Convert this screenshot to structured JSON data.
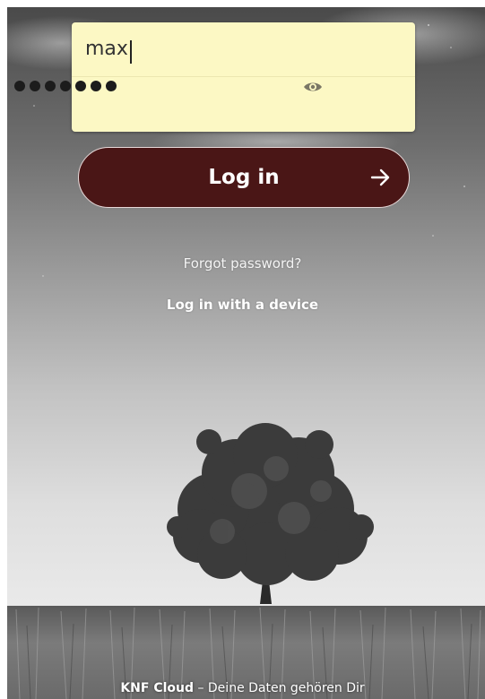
{
  "login": {
    "username_value": "max",
    "password_mask_length": 7,
    "password_visibility_icon": "eye-icon",
    "submit_label": "Log in",
    "submit_icon": "arrow-right-icon"
  },
  "links": {
    "forgot_password": "Forgot password?",
    "device_login": "Log in with a device"
  },
  "footer": {
    "brand": "KNF Cloud",
    "separator": " – ",
    "slogan": "Deine Daten gehören Dir"
  },
  "colors": {
    "field_background": "#fcf8c4",
    "button_background": "#4a1616",
    "button_border": "#e8dada",
    "link_text": "#ffffff"
  }
}
